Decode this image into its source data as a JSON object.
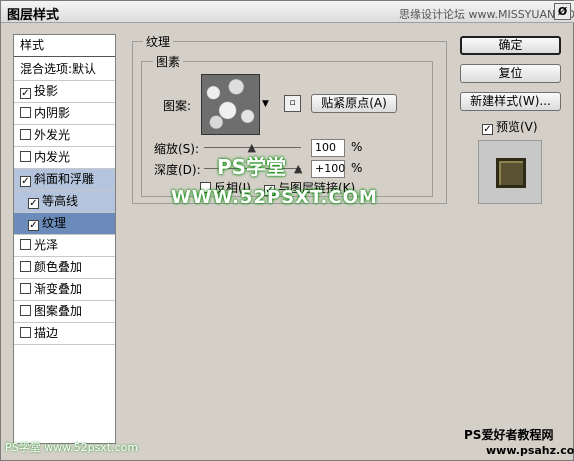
{
  "window": {
    "title": "图层样式",
    "watermark_top": "思缘设计论坛 www.MISSYUAN.COM",
    "close_label": "Ø"
  },
  "sidebar": {
    "header": "样式",
    "blend": "混合选项:默认",
    "items": [
      {
        "label": "投影",
        "checked": true
      },
      {
        "label": "内阴影",
        "checked": false
      },
      {
        "label": "外发光",
        "checked": false
      },
      {
        "label": "内发光",
        "checked": false
      },
      {
        "label": "斜面和浮雕",
        "checked": true
      },
      {
        "label": "等高线",
        "checked": true
      },
      {
        "label": "纹理",
        "checked": true
      },
      {
        "label": "光泽",
        "checked": false
      },
      {
        "label": "颜色叠加",
        "checked": false
      },
      {
        "label": "渐变叠加",
        "checked": false
      },
      {
        "label": "图案叠加",
        "checked": false
      },
      {
        "label": "描边",
        "checked": false
      }
    ]
  },
  "texture": {
    "group_title": "纹理",
    "pattern_group_title": "图素",
    "pattern_label": "图案:",
    "snap_button": "贴紧原点(A)",
    "scale_label": "缩放(S):",
    "scale_value": "100",
    "depth_label": "深度(D):",
    "depth_value": "+100",
    "percent": "%",
    "invert_label": "反相(I)",
    "link_label": "与图层链接(K)",
    "scale_level": 0.5,
    "depth_level": 0.98
  },
  "buttons": {
    "ok": "确定",
    "reset": "复位",
    "new_style": "新建样式(W)...",
    "preview": "预览(V)"
  },
  "watermarks": {
    "ps": "PS学堂",
    "url": "WWW.52PSXT.COM",
    "bottom_right": "PS爱好者教程网",
    "bottom_right2": "www.psahz.com",
    "bottom_left": "PS学堂 www.52psxt.com"
  }
}
